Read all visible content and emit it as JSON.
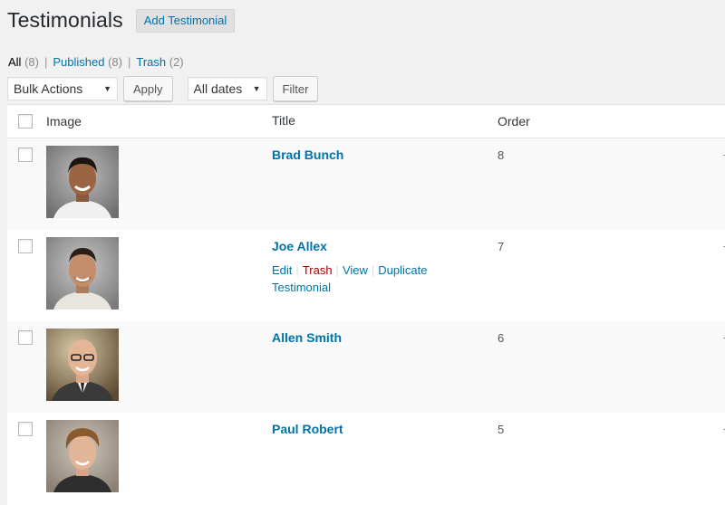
{
  "header": {
    "title": "Testimonials",
    "add_button": "Add Testimonial"
  },
  "views": {
    "all": {
      "label": "All",
      "count": "(8)"
    },
    "published": {
      "label": "Published",
      "count": "(8)"
    },
    "trash": {
      "label": "Trash",
      "count": "(2)"
    },
    "separator": "|"
  },
  "tablenav": {
    "bulk_actions": "Bulk Actions",
    "apply": "Apply",
    "dates": "All dates",
    "filter": "Filter"
  },
  "table": {
    "columns": {
      "image": "Image",
      "title": "Title",
      "order": "Order"
    },
    "rows": [
      {
        "title": "Brad Bunch",
        "order": "8"
      },
      {
        "title": "Joe Allex",
        "order": "7",
        "actions": {
          "edit": "Edit",
          "trash": "Trash",
          "view": "View",
          "duplicate": "Duplicate Testimonial"
        }
      },
      {
        "title": "Allen Smith",
        "order": "6"
      },
      {
        "title": "Paul Robert",
        "order": "5"
      }
    ]
  },
  "colors": {
    "link": "#0073aa",
    "trash_link": "#a00",
    "page_bg": "#f1f1f1",
    "table_bg": "#ffffff",
    "alt_row_bg": "#f9f9f9"
  },
  "icons": {
    "dropdown_caret": "▼"
  }
}
